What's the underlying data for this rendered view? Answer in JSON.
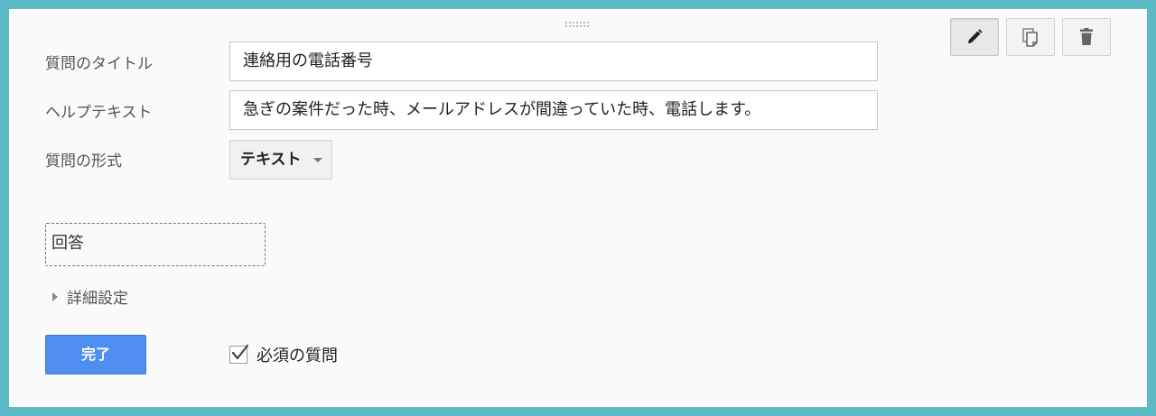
{
  "form": {
    "title_label": "質問のタイトル",
    "title_value": "連絡用の電話番号",
    "help_label": "ヘルプテキスト",
    "help_value": "急ぎの案件だった時、メールアドレスが間違っていた時、電話します。",
    "type_label": "質問の形式",
    "type_value": "テキスト",
    "answer_placeholder": "回答",
    "advanced_label": "詳細設定",
    "done_label": "完了",
    "required_label": "必須の質問",
    "required_checked": true
  },
  "toolbar": {
    "icons": [
      "pencil-icon",
      "duplicate-icon",
      "trash-icon"
    ]
  },
  "colors": {
    "page_background": "#5bbac6",
    "card_background": "#fafafa",
    "primary_button": "#4d8ef0"
  }
}
